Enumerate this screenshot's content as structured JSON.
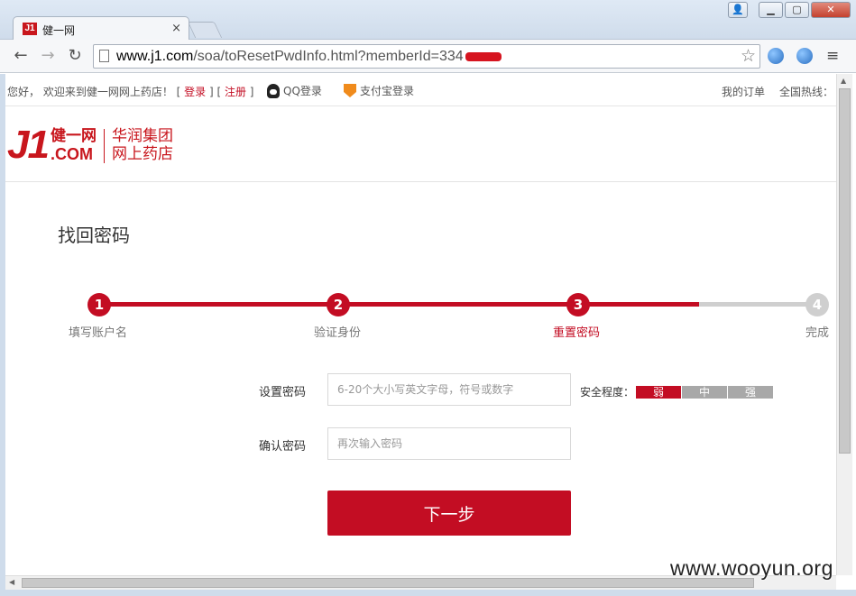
{
  "browser": {
    "tab_title": "健一网",
    "tab_favicon": "J1",
    "tab_close": "×",
    "url_host": "www.j1.com",
    "url_path": "/soa/toResetPwdInfo.html?memberId=334",
    "window_buttons": {
      "user": "👤",
      "minimize": "▁",
      "maximize": "▢",
      "close": "✕"
    },
    "nav": {
      "back": "←",
      "forward": "→",
      "reload": "↻",
      "star": "☆",
      "menu": "≡"
    }
  },
  "topbar": {
    "welcome": "您好， 欢迎来到健一网网上药店！",
    "login": "登录",
    "register": "注册",
    "qq_login": "QQ登录",
    "alipay_login": "支付宝登录",
    "my_orders": "我的订单",
    "hotline": "全国热线："
  },
  "header": {
    "logo_j1": "J1",
    "logo_cn": "健一网",
    "logo_com": ".COM",
    "logo_right_line1": "华润集团",
    "logo_right_line2": "网上药店"
  },
  "main": {
    "page_title": "找回密码",
    "steps": [
      {
        "num": "1",
        "label": "填写账户名",
        "state": "done"
      },
      {
        "num": "2",
        "label": "验证身份",
        "state": "done"
      },
      {
        "num": "3",
        "label": "重置密码",
        "state": "current"
      },
      {
        "num": "4",
        "label": "完成",
        "state": "todo"
      }
    ],
    "form": {
      "password_label": "设置密码",
      "password_placeholder": "6-20个大小写英文字母，符号或数字",
      "strength_label": "安全程度：",
      "strength_levels": [
        "弱",
        "中",
        "强"
      ],
      "strength_active": "弱",
      "confirm_label": "确认密码",
      "confirm_placeholder": "再次输入密码",
      "next_button": "下一步"
    }
  },
  "watermark": "www.wooyun.org",
  "colors": {
    "brand_red": "#c30d23",
    "inactive_gray": "#cfcfcf"
  }
}
